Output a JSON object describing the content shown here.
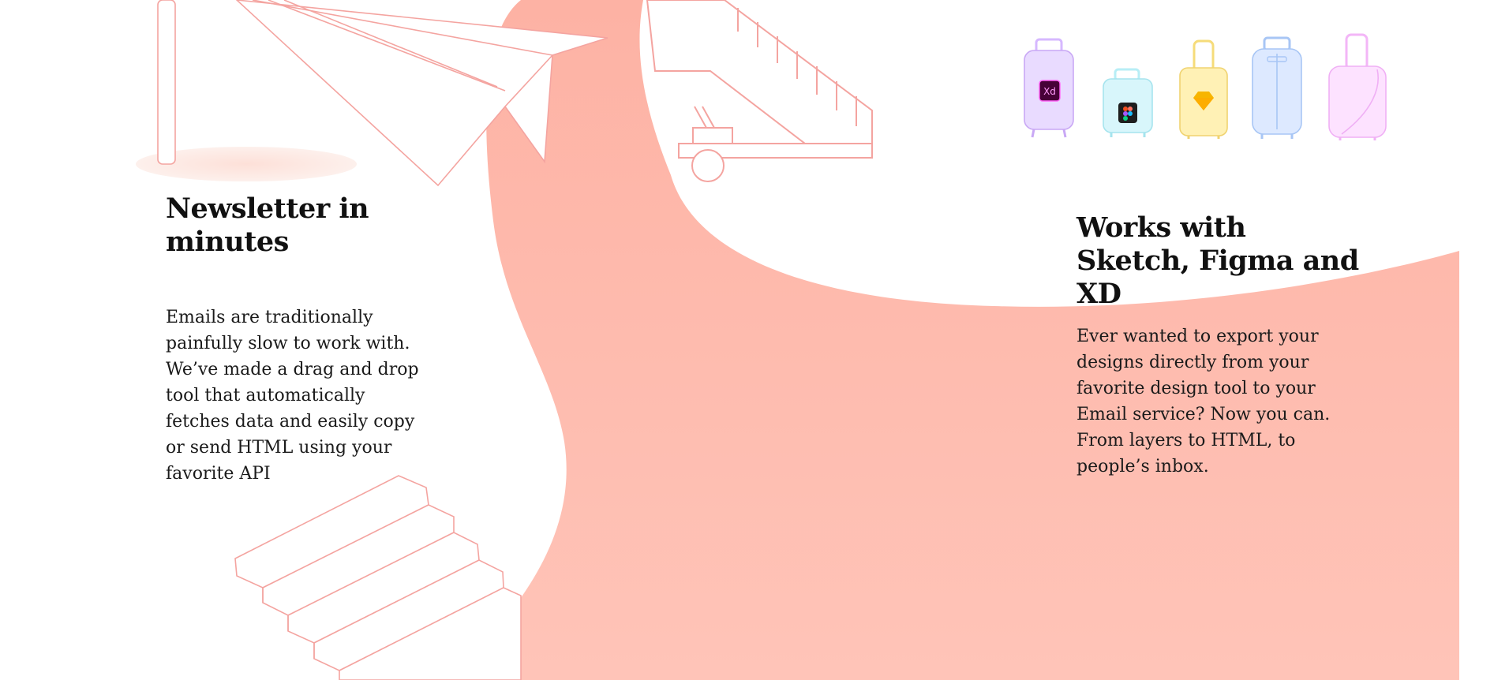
{
  "features": [
    {
      "title": "Newsletter in minutes",
      "description": "Emails are traditionally painfully slow to work with. We’ve made a drag and drop tool that automatically fetches data and easily copy or send HTML using your favorite API"
    },
    {
      "title": "Works with Sketch, Figma and XD",
      "description": "Ever wanted to export your designs directly from your favorite design tool to your Email service? Now you can. From layers to HTML, to people’s inbox."
    }
  ],
  "suitcases": [
    {
      "name": "xd",
      "badge_text": "Xd",
      "color": "#e9dbff",
      "badge_color": "#470137"
    },
    {
      "name": "figma",
      "color": "#d8f6fb",
      "badge_color": "#1e1e1e"
    },
    {
      "name": "sketch",
      "color": "#fff1b5",
      "badge_color": "#f7b500"
    },
    {
      "name": "plain-blue",
      "color": "#dde9ff"
    },
    {
      "name": "plain-pink",
      "color": "#fde2ff"
    }
  ],
  "colors": {
    "salmon": "#fdb8ab",
    "outline": "#f4a4a0",
    "text": "#111111"
  }
}
